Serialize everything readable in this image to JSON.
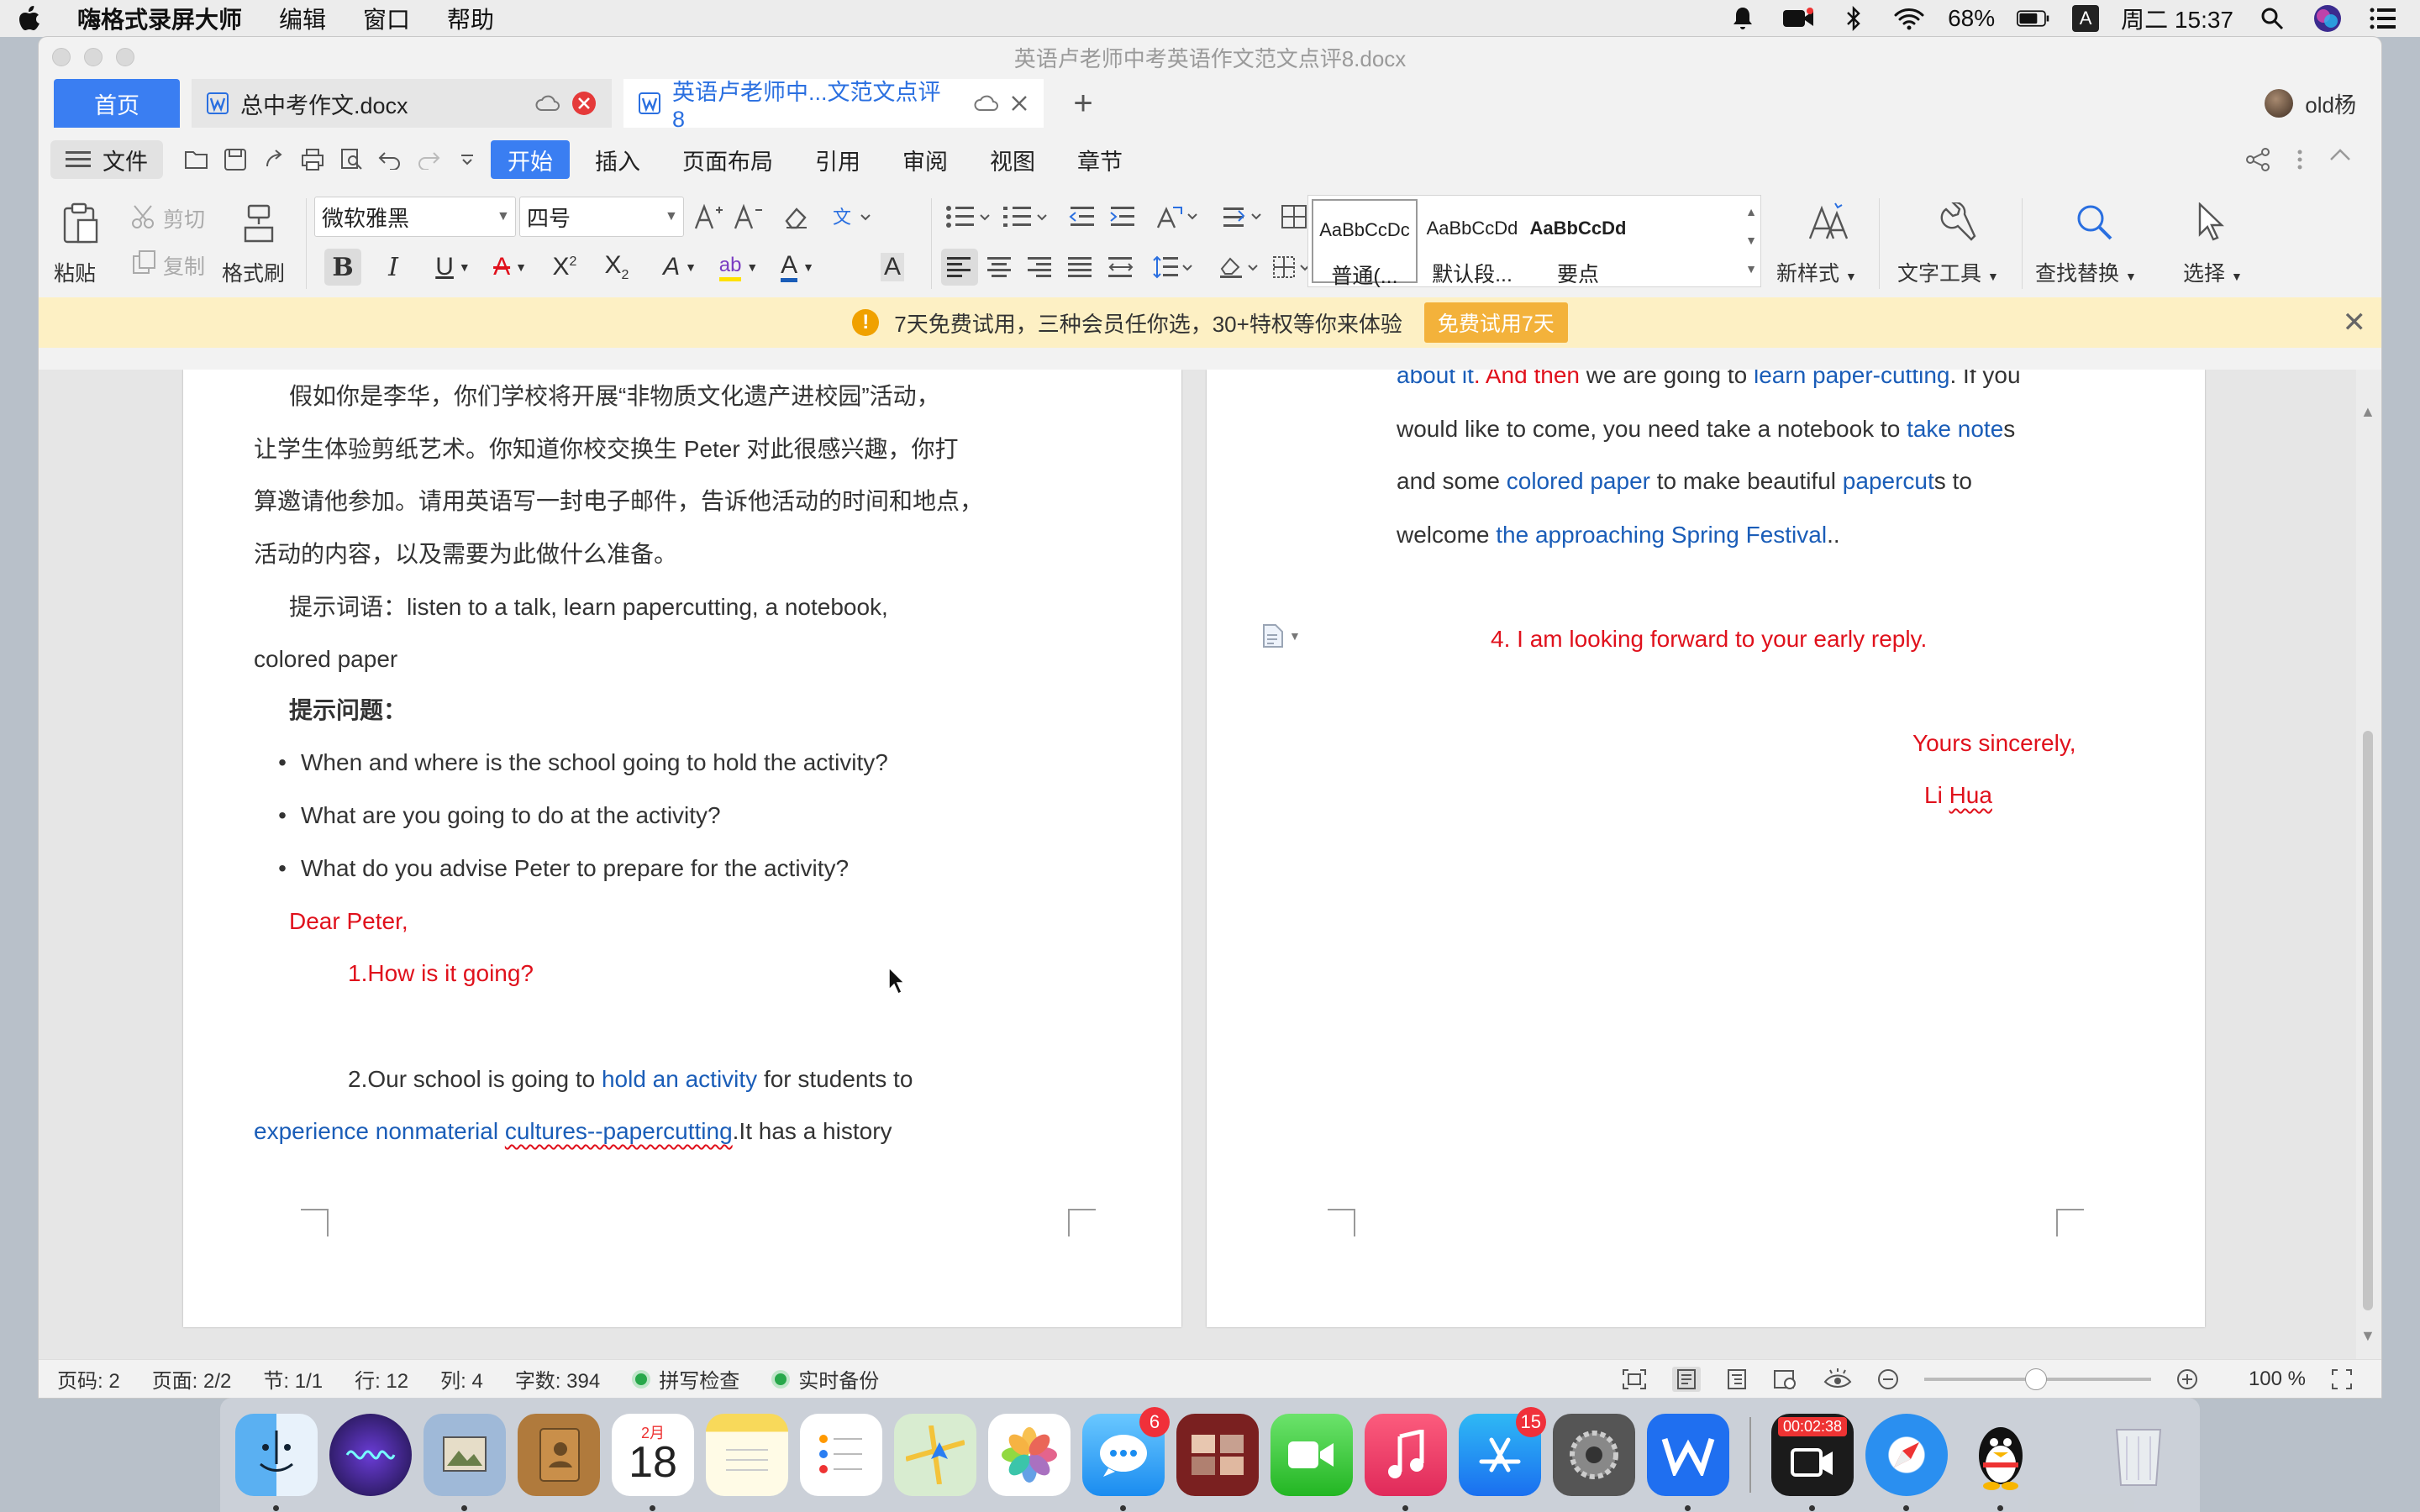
{
  "menubar": {
    "app_name": "嗨格式录屏大师",
    "menus": [
      "编辑",
      "窗口",
      "帮助"
    ],
    "battery": "68%",
    "input_method": "A",
    "datetime": "周二 15:37"
  },
  "window": {
    "title": "英语卢老师中考英语作文范文点评8.docx"
  },
  "tabs": {
    "home": "首页",
    "doc1": "总中考作文.docx",
    "doc2": "英语卢老师中...文范文点评8",
    "user": "old杨"
  },
  "ribbon": {
    "file": "文件",
    "tabs": [
      "开始",
      "插入",
      "页面布局",
      "引用",
      "审阅",
      "视图",
      "章节"
    ]
  },
  "toolbar": {
    "paste": "粘贴",
    "cut": "剪切",
    "copy": "复制",
    "format_painter": "格式刷",
    "font_name": "微软雅黑",
    "font_size": "四号",
    "styles": [
      {
        "preview": "AaBbCcDc",
        "name": "普通(..."
      },
      {
        "preview": "AaBbCcDd",
        "name": "默认段..."
      },
      {
        "preview": "AaBbCcDd",
        "name": "要点"
      }
    ],
    "new_style": "新样式",
    "text_tools": "文字工具",
    "find_replace": "查找替换",
    "select": "选择"
  },
  "notice": {
    "text": "7天免费试用，三种会员任你选，30+特权等你来体验",
    "button": "免费试用7天"
  },
  "page1": {
    "para1": [
      "假如你是李华，你们学校将开展“非物质文化遗产进校园”活动，",
      "让学生体验剪纸艺术。你知道你校交换生 Peter 对此很感兴趣，你打",
      "算邀请他参加。请用英语写一封电子邮件，告诉他活动的时间和地点，",
      "活动的内容，以及需要为此做什么准备。"
    ],
    "hint_words_1": "提示词语：listen to a talk, learn papercutting, a notebook,",
    "hint_words_2": "colored paper",
    "hint_q_title": "提示问题：",
    "questions": [
      "When and where is the school going to hold the activity?",
      "What are you going to do at the activity?",
      "What do you advise Peter to prepare for the activity?"
    ],
    "greeting": "Dear Peter,",
    "line1": "1.How is it going?",
    "line2_a": "2.Our school is going to ",
    "line2_b": "hold an activity",
    "line2_c": " for students to",
    "line3_a": "experience nonmaterial ",
    "line3_b": "cultures--papercutting",
    "line3_c": ".It has a history"
  },
  "page2": {
    "l1_a": "about it",
    "l1_b": ". And then",
    "l1_c": " we are going to ",
    "l1_d": "learn paper-cutting",
    "l1_e": ". If you",
    "l2_a": "would like to come, you need take a notebook to ",
    "l2_b": "take note",
    "l2_c": "s",
    "l3_a": "and some ",
    "l3_b": "colored paper",
    "l3_c": " to make beautiful ",
    "l3_d": "papercut",
    "l3_e": "s to",
    "l4_a": "welcome ",
    "l4_b": "the approaching Spring Festival",
    "l4_c": "..",
    "line4": "4. I am looking forward to your early reply.",
    "closing": "Yours sincerely,",
    "sign_a": "Li ",
    "sign_b": "Hua"
  },
  "statusbar": {
    "page_no": "页码: 2",
    "pages": "页面: 2/2",
    "section": "节: 1/1",
    "row": "行: 12",
    "col": "列: 4",
    "words": "字数: 394",
    "spell": "拼写检查",
    "backup": "实时备份",
    "zoom": "100 %"
  },
  "dock": {
    "calendar_month": "2月",
    "calendar_day": "18",
    "messages_badge": "6",
    "appstore_badge": "15",
    "recorder_time": "00:02:38"
  },
  "colors": {
    "accent": "#3a7ef2",
    "red_text": "#e0111c",
    "blue_text": "#1a5db8",
    "notice_bg": "#fdf0c4"
  }
}
